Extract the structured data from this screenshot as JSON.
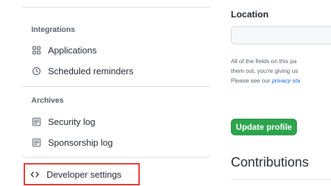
{
  "sidebar": {
    "integrations_title": "Integrations",
    "integrations_items": [
      {
        "label": "Applications",
        "icon": "apps-grid-icon"
      },
      {
        "label": "Scheduled reminders",
        "icon": "clock-icon"
      }
    ],
    "archives_title": "Archives",
    "archives_items": [
      {
        "label": "Security log",
        "icon": "log-icon"
      },
      {
        "label": "Sponsorship log",
        "icon": "log-icon"
      }
    ],
    "developer_settings": {
      "label": "Developer settings",
      "icon": "code-icon",
      "highlight_color": "#e8302a"
    }
  },
  "main": {
    "location_label": "Location",
    "location_value": "",
    "note_line1": "All of the fields on this pa",
    "note_line2": "them out, you're giving us",
    "note_line3_prefix": "Please see our ",
    "note_link": "privacy sta",
    "update_button": "Update profile",
    "contributions_title": "Contributions"
  },
  "colors": {
    "primary_button": "#2da44e",
    "link": "#0969da",
    "highlight": "#e8302a"
  }
}
